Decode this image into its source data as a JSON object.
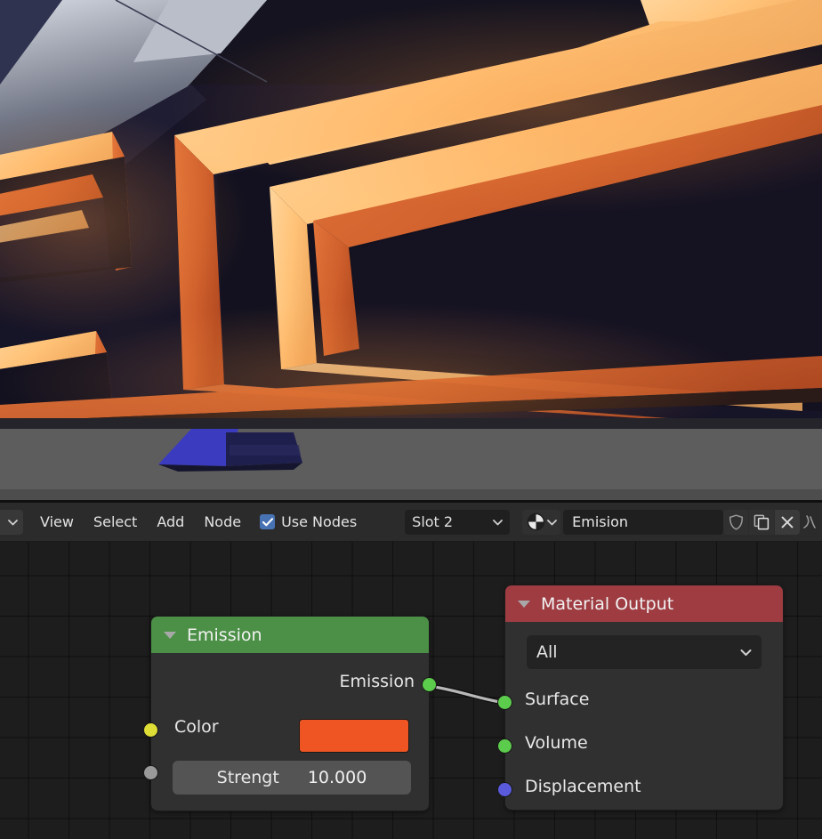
{
  "viewport": {
    "name": "3d-viewport-render",
    "description": "Rendered preview of glowing nested rectangular emission frames",
    "background_color": "#15131f",
    "floor_color": "#5d5d5d",
    "emission_bright": "#ffc682",
    "emission_mid": "#e0813c",
    "emission_deep": "#c3562a",
    "object_blue": "#3a3ab8"
  },
  "header": {
    "editor_type_icon": "node-editor-icon",
    "menus": [
      {
        "label": "View"
      },
      {
        "label": "Select"
      },
      {
        "label": "Add"
      },
      {
        "label": "Node"
      }
    ],
    "use_nodes": {
      "label": "Use Nodes",
      "checked": true,
      "checkbox_color": "#4772b3"
    },
    "slot_dropdown": {
      "value": "Slot 2",
      "icon": "chevron-down-icon"
    },
    "material_browse_icon": "material-sphere-icon",
    "material_name": {
      "value": "Emision",
      "placeholder": "Material name"
    },
    "buttons": [
      {
        "name": "fake-user-button",
        "icon": "shield-icon"
      },
      {
        "name": "new-material-button",
        "icon": "copy-icon"
      },
      {
        "name": "unlink-material-button",
        "icon": "close-x-icon"
      },
      {
        "name": "overflow-button",
        "icon": "partial-icon"
      }
    ]
  },
  "canvas": {
    "grid_color": "#000000",
    "background_color": "#1d1d1d",
    "noodle_color": "#b8b8b8"
  },
  "nodes": [
    {
      "id": "emission",
      "title": "Emission",
      "header_color": "#4b9046",
      "collapse_icon": "triangle-down-icon",
      "outputs": [
        {
          "label": "Emission",
          "socket_color": "#5ccc4c",
          "socket_type": "shader"
        }
      ],
      "inputs": [
        {
          "label": "Color",
          "socket_color": "#dede36",
          "socket_type": "color",
          "value": "#ee5522"
        },
        {
          "label": "Strengt",
          "socket_color": "#9a9a9a",
          "socket_type": "value",
          "value": "10.000"
        }
      ]
    },
    {
      "id": "material-output",
      "title": "Material Output",
      "header_color": "#9e3c42",
      "collapse_icon": "triangle-down-icon",
      "target_dropdown": {
        "value": "All",
        "icon": "chevron-down-icon"
      },
      "inputs": [
        {
          "label": "Surface",
          "socket_color": "#5ccc4c",
          "socket_type": "shader"
        },
        {
          "label": "Volume",
          "socket_color": "#5ccc4c",
          "socket_type": "shader"
        },
        {
          "label": "Displacement",
          "socket_color": "#5a5add",
          "socket_type": "vector"
        }
      ]
    }
  ],
  "links": [
    {
      "from": "emission.Emission",
      "to": "material-output.Surface"
    }
  ]
}
